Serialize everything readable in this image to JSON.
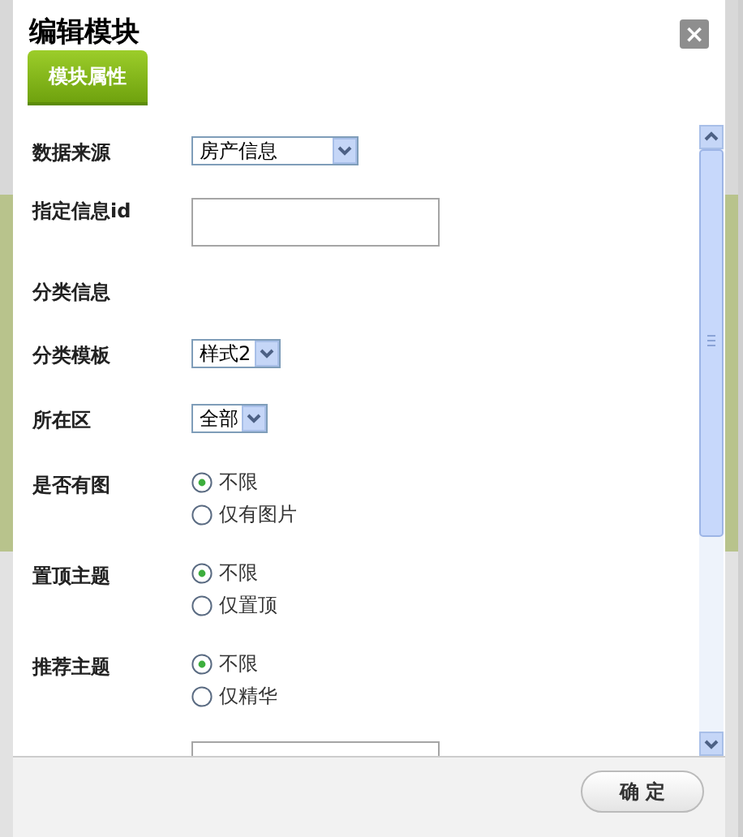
{
  "dialog": {
    "title": "编辑模块",
    "close": "×"
  },
  "tabs": [
    {
      "label": "模块属性",
      "selected": true
    }
  ],
  "fields": [
    {
      "kind": "select",
      "label": "数据来源",
      "value": "房产信息"
    },
    {
      "kind": "text",
      "label": "指定信息id"
    },
    {
      "kind": "heading",
      "label": "分类信息"
    },
    {
      "kind": "select",
      "label": "分类模板",
      "value": "样式2"
    },
    {
      "kind": "select",
      "label": "所在区",
      "value": "全部"
    },
    {
      "kind": "radio",
      "label": "是否有图",
      "options": [
        {
          "label": "不限",
          "selected": true
        },
        {
          "label": "仅有图片",
          "selected": false
        }
      ]
    },
    {
      "kind": "radio",
      "label": "置顶主题",
      "options": [
        {
          "label": "不限",
          "selected": true
        },
        {
          "label": "仅置顶",
          "selected": false
        }
      ]
    },
    {
      "kind": "radio",
      "label": "推荐主题",
      "options": [
        {
          "label": "不限",
          "selected": true
        },
        {
          "label": "仅精华",
          "selected": false
        }
      ]
    },
    {
      "kind": "partial"
    }
  ],
  "buttons": [
    "确 定"
  ]
}
